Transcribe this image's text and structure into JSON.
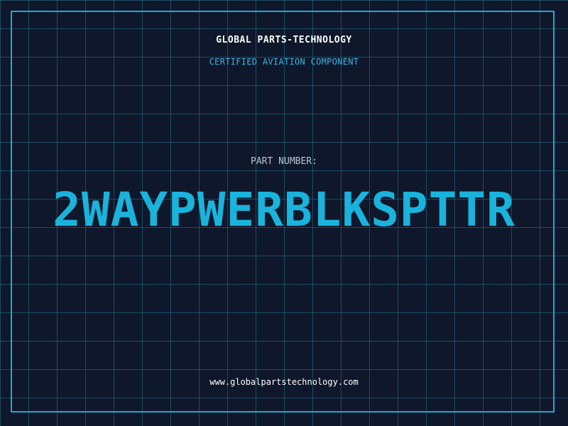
{
  "header": {
    "company": "GLOBAL PARTS-TECHNOLOGY",
    "subtitle": "CERTIFIED AVIATION COMPONENT"
  },
  "part": {
    "label": "PART NUMBER:",
    "number": "2WAYPWERBLKSPTTR"
  },
  "footer": {
    "website": "www.globalpartstechnology.com"
  },
  "colors": {
    "background": "#0f172a",
    "grid": "#228caa",
    "accent": "#19b3dc",
    "border": "#1fa8d6"
  }
}
